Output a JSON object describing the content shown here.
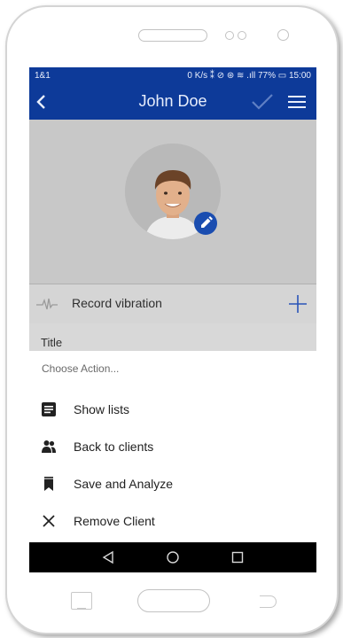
{
  "status_bar": {
    "carrier": "1&1",
    "right_info": "0 K/s  ⁑ ⊘ ⊛ ≋ .ıll 77% ▭ 15:00"
  },
  "app_bar": {
    "title": "John Doe",
    "back_icon": "chevron-left",
    "confirm_icon": "checkmark",
    "menu_icon": "hamburger-menu"
  },
  "profile": {
    "avatar_alt": "profile photo",
    "edit_icon": "pencil"
  },
  "vibration_row": {
    "label": "Record vibration",
    "icon": "waveform",
    "add_icon": "plus"
  },
  "form": {
    "title_label": "Title"
  },
  "action_sheet": {
    "header": "Choose Action...",
    "items": [
      {
        "label": "Show lists",
        "icon": "list-document"
      },
      {
        "label": "Back to clients",
        "icon": "people"
      },
      {
        "label": "Save and Analyze",
        "icon": "bookmark"
      },
      {
        "label": "Remove Client",
        "icon": "close-x"
      }
    ]
  },
  "colors": {
    "primary": "#0d3a99",
    "accent": "#1a4db0",
    "overlay_gray": "#c8c8c8"
  }
}
